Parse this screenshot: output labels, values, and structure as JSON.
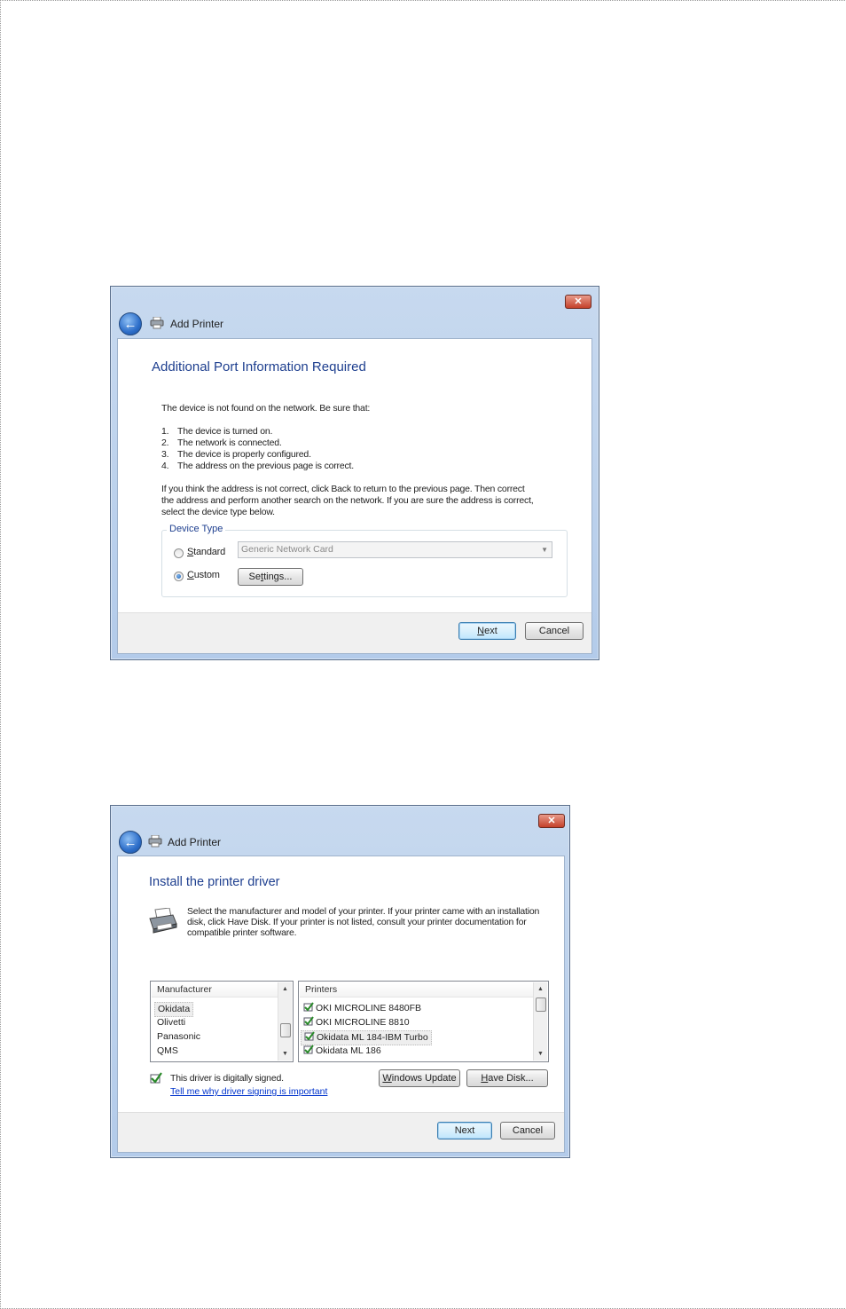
{
  "dialog1": {
    "title": "Add Printer",
    "close_label": "✕",
    "back_label": "←",
    "heading": "Additional Port Information Required",
    "intro": "The device is not found on the network.  Be sure that:",
    "checklist": [
      {
        "num": "1.",
        "text": "The device is turned on."
      },
      {
        "num": "2.",
        "text": "The network is connected."
      },
      {
        "num": "3.",
        "text": "The device is properly configured."
      },
      {
        "num": "4.",
        "text": "The address on the previous page is correct."
      }
    ],
    "advice_lines": [
      "If you think the address is not correct, click Back to return to the previous page.  Then correct",
      "the address and perform another search on the network.  If you are sure the address is correct,",
      "select the device type below."
    ],
    "device_type": {
      "legend": "Device Type",
      "standard_label_first": "S",
      "standard_label_rest": "tandard",
      "custom_label_first": "C",
      "custom_label_rest": "ustom",
      "selected": "custom",
      "standard_value": "Generic Network Card",
      "settings_first": "Se",
      "settings_u": "t",
      "settings_rest": "tings..."
    },
    "next_first": "N",
    "next_rest": "ext",
    "cancel_label": "Cancel"
  },
  "dialog2": {
    "title": "Add Printer",
    "close_label": "✕",
    "back_label": "←",
    "heading": "Install the printer driver",
    "instructions_lines": [
      "Select the manufacturer and model of your printer. If your printer came with an installation",
      "disk, click Have Disk. If your printer is not listed, consult your printer documentation for",
      "compatible printer software."
    ],
    "manufacturer": {
      "header": "Manufacturer",
      "items": [
        "Okidata",
        "Olivetti",
        "Panasonic",
        "QMS"
      ],
      "selected_index": 0
    },
    "printers": {
      "header": "Printers",
      "items": [
        "OKI MICROLINE 8480FB",
        "OKI MICROLINE 8810",
        "Okidata ML 184-IBM Turbo",
        "Okidata ML 186"
      ],
      "selected_index": 2
    },
    "signed_text": "This driver is digitally signed.",
    "signing_link": "Tell me why driver signing is important",
    "windows_update_first": "W",
    "windows_update_rest": "indows Update",
    "have_disk_first": "H",
    "have_disk_rest": "ave Disk...",
    "next_label": "Next",
    "cancel_label": "Cancel"
  },
  "icons": {
    "close": "close-icon",
    "back": "back-arrow-icon",
    "printer": "printer-icon",
    "driver_signed": "signed-driver-icon"
  }
}
